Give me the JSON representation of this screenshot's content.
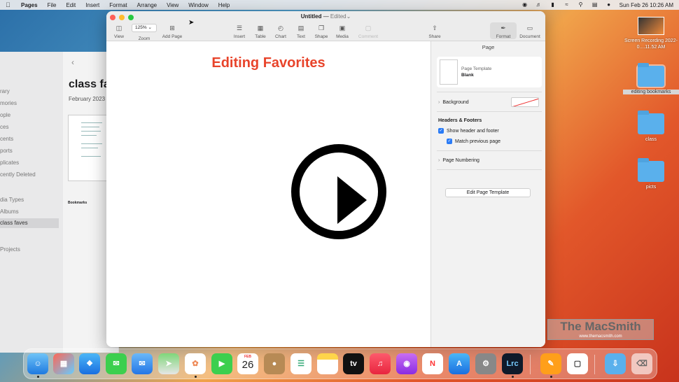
{
  "menubar": {
    "app_name": "Pages",
    "items": [
      "File",
      "Edit",
      "Insert",
      "Format",
      "Arrange",
      "View",
      "Window",
      "Help"
    ],
    "datetime": "Sun Feb 26  10:26 AM"
  },
  "photos": {
    "sidebar_items": [
      "rary",
      "mories",
      "ople",
      "ces",
      "cents",
      "ports",
      "plicates",
      "cently Deleted",
      "dia Types",
      "Albums",
      "class faves",
      "Projects"
    ],
    "active_item": "class faves",
    "title": "class fa",
    "date": "February 2023",
    "doc_title": "Bookmarks"
  },
  "pages": {
    "title": {
      "doc": "Untitled",
      "sep": " — ",
      "status": "Edited"
    },
    "zoom": "125%",
    "toolbar": {
      "view": "View",
      "zoom": "Zoom",
      "add_page": "Add Page",
      "insert": "Insert",
      "table": "Table",
      "chart": "Chart",
      "text": "Text",
      "shape": "Shape",
      "media": "Media",
      "comment": "Comment",
      "share": "Share",
      "format": "Format",
      "document": "Document"
    },
    "heading": "Editing Favorites",
    "sidebar": {
      "tab": "Page",
      "template_label": "Page Template",
      "template_name": "Blank",
      "background": "Background",
      "headers_footers": "Headers & Footers",
      "show_header_footer": "Show header and footer",
      "match_previous": "Match previous page",
      "page_numbering": "Page Numbering",
      "edit_template": "Edit Page Template"
    }
  },
  "desktop": {
    "icons": [
      {
        "label": "Screen Recording 2022-0....11.52 AM"
      },
      {
        "label": "editing bookmarks"
      },
      {
        "label": "class"
      },
      {
        "label": "picts"
      }
    ]
  },
  "watermark": {
    "title": "The MacSmith",
    "url": "www.themacsmith.com"
  },
  "dock": {
    "calendar_month": "FEB",
    "calendar_day": "26",
    "tv_label": "tv",
    "lrc_label": "Lrc"
  },
  "colors": {
    "heading": "#e8442b",
    "accent": "#2a7bf6"
  }
}
